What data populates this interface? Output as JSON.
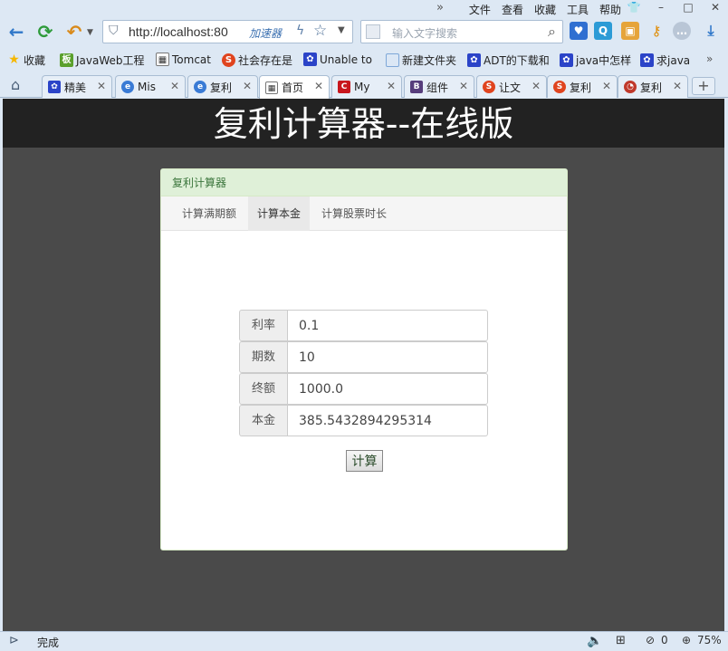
{
  "menu": {
    "more": "»",
    "items": [
      "文件",
      "查看",
      "收藏",
      "工具",
      "帮助"
    ]
  },
  "window_controls": {
    "skin": "👕",
    "minimize": "–",
    "maximize": "□",
    "close": "✕"
  },
  "nav": {
    "url": "http://localhost:80",
    "accelerator_label": "加速器",
    "search_placeholder": "输入文字搜索"
  },
  "bookmarks": {
    "items": [
      {
        "label": "收藏",
        "icon": "star-icon",
        "color": "#f5b700",
        "glyph": "★"
      },
      {
        "label": "JavaWeb工程",
        "icon": "green-board-icon",
        "color": "#5aa02c",
        "glyph": "板"
      },
      {
        "label": "Tomcat",
        "icon": "page-icon",
        "color": "#8a8a8a",
        "glyph": "▦"
      },
      {
        "label": "社会存在是",
        "icon": "sogou-icon",
        "color": "#e0441f",
        "glyph": "S"
      },
      {
        "label": "Unable to",
        "icon": "baidu-paw-icon",
        "color": "#2b44c8",
        "glyph": "✿"
      },
      {
        "label": "新建文件夹",
        "icon": "folder-icon",
        "color": "#7ea7d8",
        "glyph": "▭"
      },
      {
        "label": "ADT的下载和",
        "icon": "baidu-paw-icon",
        "color": "#2b44c8",
        "glyph": "✿"
      },
      {
        "label": "java中怎样",
        "icon": "baidu-paw-icon",
        "color": "#2b44c8",
        "glyph": "✿"
      },
      {
        "label": "求java",
        "icon": "baidu-paw-icon",
        "color": "#2b44c8",
        "glyph": "✿"
      }
    ],
    "more": "»"
  },
  "tabs": [
    {
      "label": "精美",
      "icon": "baidu-paw-icon",
      "color": "#2b44c8",
      "glyph": "✿"
    },
    {
      "label": "Mis",
      "icon": "ie-icon",
      "color": "#3a7bd5",
      "glyph": "e"
    },
    {
      "label": "复利",
      "icon": "ie-icon",
      "color": "#3a7bd5",
      "glyph": "e"
    },
    {
      "label": "首页",
      "icon": "page-icon",
      "color": "#8a8a8a",
      "glyph": "▦",
      "active": true
    },
    {
      "label": "My",
      "icon": "csdn-icon",
      "color": "#c8161d",
      "glyph": "C"
    },
    {
      "label": "组件",
      "icon": "bootstrap-icon",
      "color": "#563d7c",
      "glyph": "B"
    },
    {
      "label": "让文",
      "icon": "sogou-icon",
      "color": "#e0441f",
      "glyph": "S"
    },
    {
      "label": "复利",
      "icon": "sogou-icon",
      "color": "#e0441f",
      "glyph": "S"
    },
    {
      "label": "复利",
      "icon": "chart-icon",
      "color": "#c0392b",
      "glyph": "◔"
    }
  ],
  "page": {
    "title": "复利计算器--在线版",
    "panel_heading": "复利计算器",
    "tabs": [
      "计算满期额",
      "计算本金",
      "计算股票时长"
    ],
    "active_tab": 1,
    "fields": [
      {
        "label": "利率",
        "value": "0.1"
      },
      {
        "label": "期数",
        "value": "10"
      },
      {
        "label": "终额",
        "value": "1000.0"
      },
      {
        "label": "本金",
        "value": "385.5432894295314"
      }
    ],
    "calc_button": "计算"
  },
  "status": {
    "text": "完成",
    "count": "0",
    "zoom": "75%"
  },
  "colors": {
    "chrome_bg": "#dde8f4",
    "header_bg": "#222222",
    "page_bg": "#4a4a4a",
    "panel_heading_bg": "#dff0d8",
    "panel_heading_text": "#3c763d"
  }
}
